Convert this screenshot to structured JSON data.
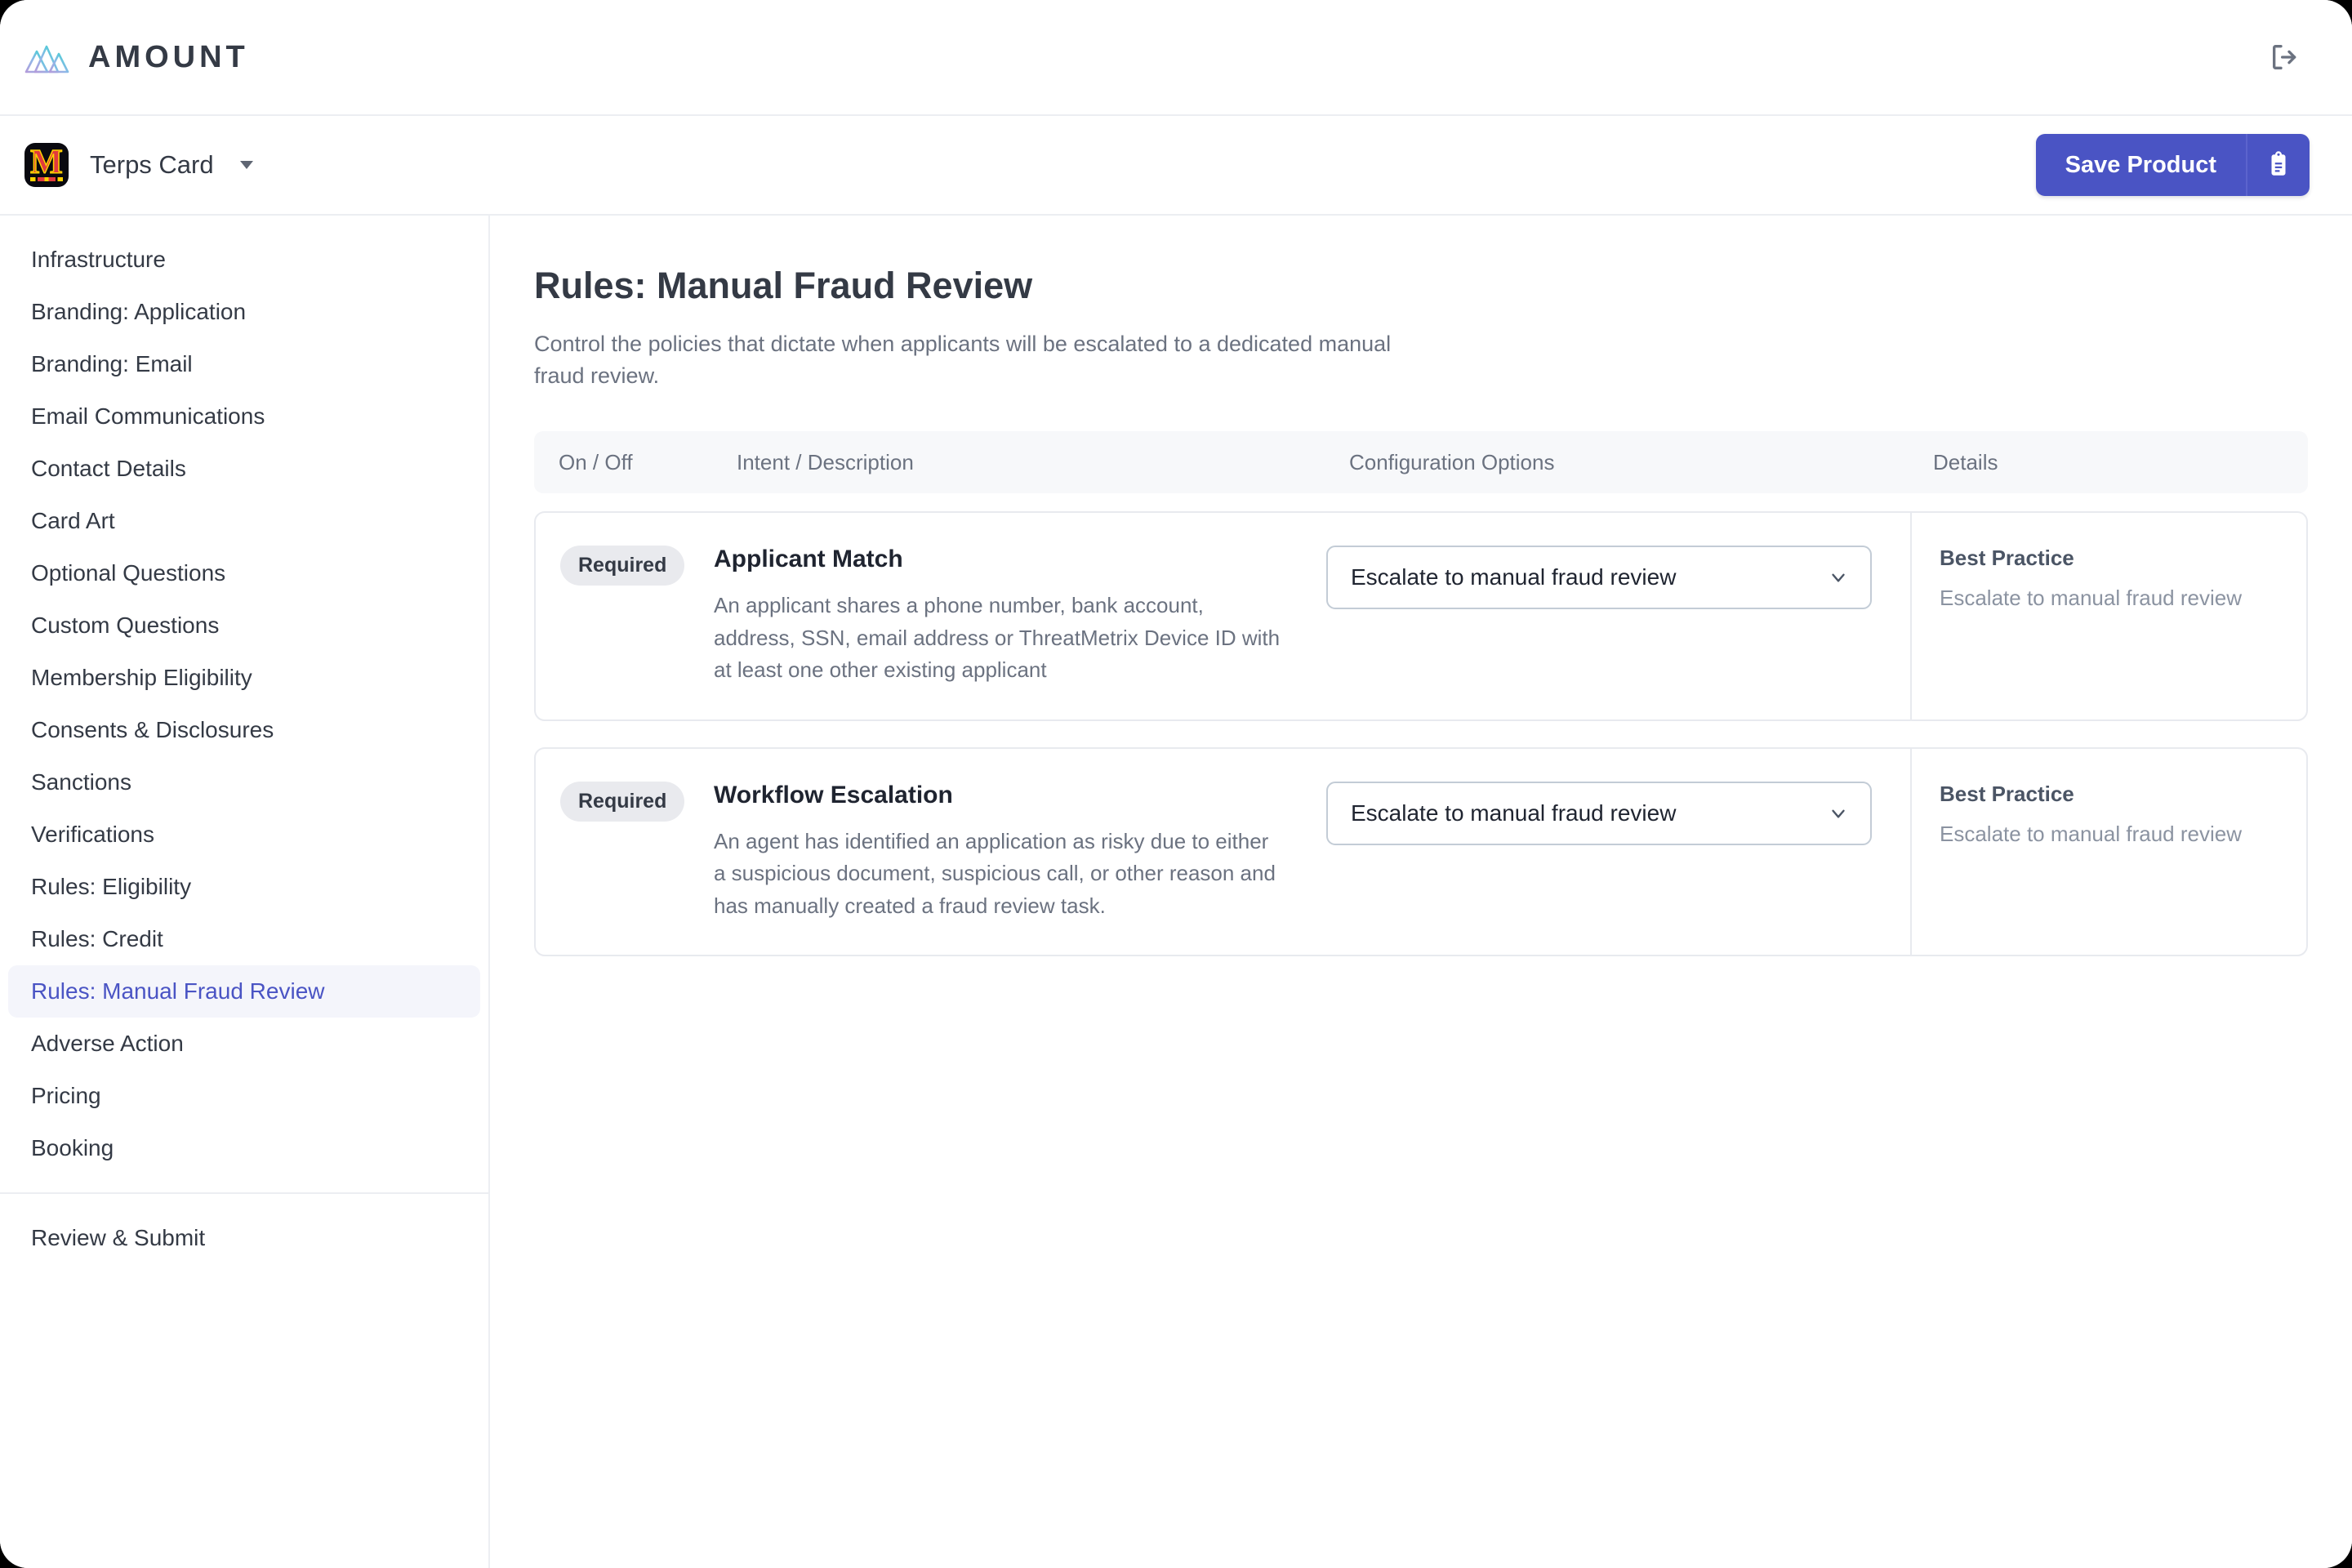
{
  "topbar": {
    "brand_name": "AMOUNT",
    "brand_logo_icon": "amount-mountains-logo",
    "logout_icon": "logout-icon"
  },
  "productbar": {
    "product_name": "Terps Card",
    "product_logo_icon": "maryland-m-logo",
    "product_logo_letter": "M",
    "dropdown_icon": "caret-down-icon",
    "save_label": "Save Product",
    "save_icon": "clipboard-icon",
    "accent_color": "#4a54c4"
  },
  "sidebar": {
    "items": [
      {
        "label": "Infrastructure",
        "active": false
      },
      {
        "label": "Branding: Application",
        "active": false
      },
      {
        "label": "Branding: Email",
        "active": false
      },
      {
        "label": "Email Communications",
        "active": false
      },
      {
        "label": "Contact Details",
        "active": false
      },
      {
        "label": "Card Art",
        "active": false
      },
      {
        "label": "Optional Questions",
        "active": false
      },
      {
        "label": "Custom Questions",
        "active": false
      },
      {
        "label": "Membership Eligibility",
        "active": false
      },
      {
        "label": "Consents & Disclosures",
        "active": false
      },
      {
        "label": "Sanctions",
        "active": false
      },
      {
        "label": "Verifications",
        "active": false
      },
      {
        "label": "Rules: Eligibility",
        "active": false
      },
      {
        "label": "Rules: Credit",
        "active": false
      },
      {
        "label": "Rules: Manual Fraud Review",
        "active": true
      },
      {
        "label": "Adverse Action",
        "active": false
      },
      {
        "label": "Pricing",
        "active": false
      },
      {
        "label": "Booking",
        "active": false
      }
    ],
    "footer_items": [
      {
        "label": "Review & Submit"
      }
    ],
    "active_color": "#4a54c4"
  },
  "main": {
    "title": "Rules: Manual Fraud Review",
    "subtitle": "Control the policies that dictate when applicants will be escalated to a dedicated manual fraud review.",
    "table": {
      "columns": [
        "On / Off",
        "Intent / Description",
        "Configuration Options",
        "Details"
      ],
      "rows": [
        {
          "status_badge": "Required",
          "name": "Applicant Match",
          "description": "An applicant shares a phone number, bank account, address, SSN, email address or ThreatMetrix Device ID with at least one other existing applicant",
          "config_value": "Escalate to manual fraud review",
          "config_icon": "chevron-down-icon",
          "details_title": "Best Practice",
          "details_text": "Escalate to manual fraud review"
        },
        {
          "status_badge": "Required",
          "name": "Workflow Escalation",
          "description": "An agent has identified an application as risky due to either a suspicious document, suspicious call, or other reason and has manually created a fraud review task.",
          "config_value": "Escalate to manual fraud review",
          "config_icon": "chevron-down-icon",
          "details_title": "Best Practice",
          "details_text": "Escalate to manual fraud review"
        }
      ]
    }
  }
}
